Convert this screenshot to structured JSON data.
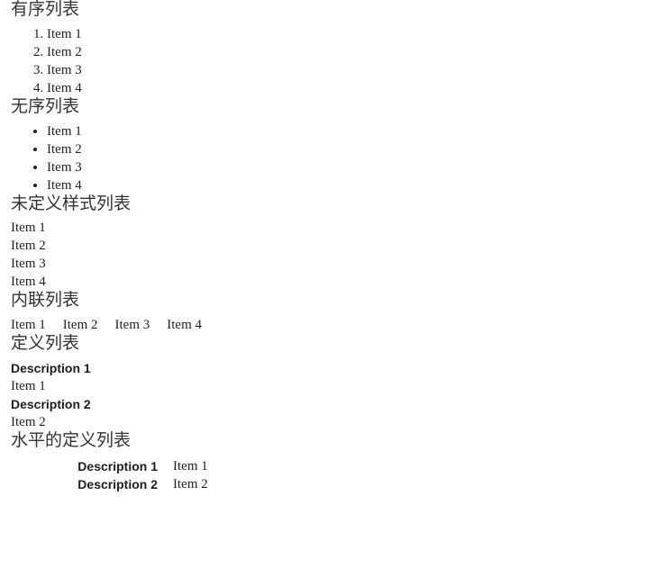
{
  "sections": {
    "ordered": {
      "heading": "有序列表",
      "items": [
        "Item 1",
        "Item 2",
        "Item 3",
        "Item 4"
      ]
    },
    "unordered": {
      "heading": "无序列表",
      "items": [
        "Item 1",
        "Item 2",
        "Item 3",
        "Item 4"
      ]
    },
    "unstyled": {
      "heading": "未定义样式列表",
      "items": [
        "Item 1",
        "Item 2",
        "Item 3",
        "Item 4"
      ]
    },
    "inline": {
      "heading": "内联列表",
      "items": [
        "Item 1",
        "Item 2",
        "Item 3",
        "Item 4"
      ]
    },
    "definition": {
      "heading": "定义列表",
      "entries": [
        {
          "term": "Description 1",
          "desc": "Item 1"
        },
        {
          "term": "Description 2",
          "desc": "Item 2"
        }
      ]
    },
    "definition_horizontal": {
      "heading": "水平的定义列表",
      "entries": [
        {
          "term": "Description 1",
          "desc": "Item 1"
        },
        {
          "term": "Description 2",
          "desc": "Item 2"
        }
      ]
    }
  },
  "colors": {
    "background": "#ffffff",
    "heading_text": "#333333",
    "body_text": "#222222",
    "term_text": "#1d1d1d"
  }
}
